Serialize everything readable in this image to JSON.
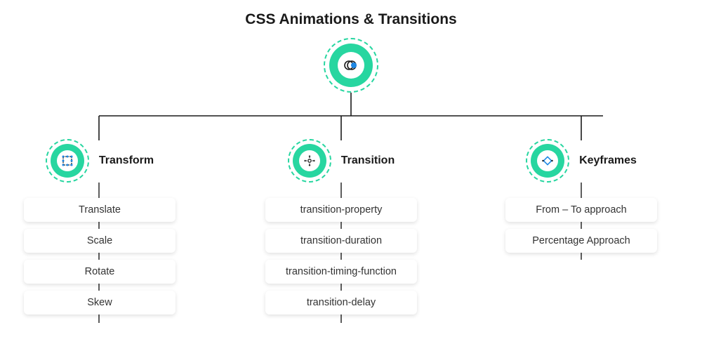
{
  "title": "CSS Animations & Transitions",
  "root": {
    "icon": "animation-rings-icon"
  },
  "branches": [
    {
      "key": "transform",
      "label": "Transform",
      "icon": "transform-grid-icon",
      "items": [
        "Translate",
        "Scale",
        "Rotate",
        "Skew"
      ]
    },
    {
      "key": "transition",
      "label": "Transition",
      "icon": "transition-arrows-icon",
      "items": [
        "transition-property",
        "transition-duration",
        "transition-timing-function",
        "transition-delay"
      ]
    },
    {
      "key": "keyframes",
      "label": "Keyframes",
      "icon": "keyframe-diamond-icon",
      "items": [
        "From – To approach",
        "Percentage Approach"
      ]
    }
  ],
  "colors": {
    "accent": "#27d6a0",
    "text": "#1a1a1a"
  }
}
